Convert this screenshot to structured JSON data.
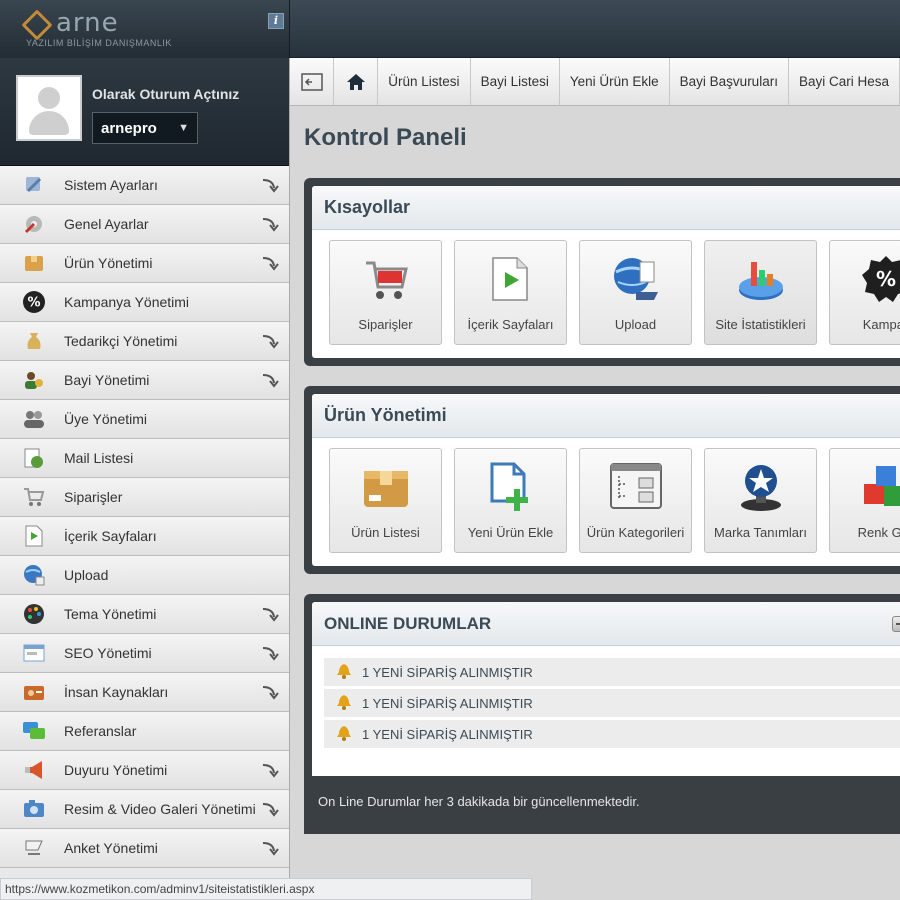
{
  "header": {
    "logo_text": "arne",
    "logo_subtitle": "YAZILIM BİLİŞİM DANIŞMANLIK",
    "info_label": "i"
  },
  "user": {
    "status_text": "Olarak Oturum Açtınız",
    "username": "arnepro"
  },
  "sidebar": {
    "items": [
      {
        "label": "Sistem Ayarları",
        "icon": "settings-tools-icon",
        "has_submenu": true
      },
      {
        "label": "Genel Ayarlar",
        "icon": "gear-wrench-icon",
        "has_submenu": true
      },
      {
        "label": "Ürün Yönetimi",
        "icon": "box-icon",
        "has_submenu": true
      },
      {
        "label": "Kampanya Yönetimi",
        "icon": "percent-badge-icon",
        "has_submenu": false
      },
      {
        "label": "Tedarikçi Yönetimi",
        "icon": "money-bag-icon",
        "has_submenu": true
      },
      {
        "label": "Bayi Yönetimi",
        "icon": "dealer-people-icon",
        "has_submenu": true
      },
      {
        "label": "Üye Yönetimi",
        "icon": "members-icon",
        "has_submenu": false
      },
      {
        "label": "Mail Listesi",
        "icon": "mail-list-icon",
        "has_submenu": false
      },
      {
        "label": "Siparişler",
        "icon": "shopping-cart-icon",
        "has_submenu": false
      },
      {
        "label": "İçerik Sayfaları",
        "icon": "content-page-icon",
        "has_submenu": false
      },
      {
        "label": "Upload",
        "icon": "upload-globe-icon",
        "has_submenu": false
      },
      {
        "label": "Tema Yönetimi",
        "icon": "palette-icon",
        "has_submenu": true
      },
      {
        "label": "SEO Yönetimi",
        "icon": "seo-window-icon",
        "has_submenu": true
      },
      {
        "label": "İnsan Kaynakları",
        "icon": "id-card-icon",
        "has_submenu": true
      },
      {
        "label": "Referanslar",
        "icon": "chat-bubbles-icon",
        "has_submenu": false
      },
      {
        "label": "Duyuru Yönetimi",
        "icon": "megaphone-icon",
        "has_submenu": true
      },
      {
        "label": "Resim & Video Galeri Yönetimi",
        "icon": "camera-icon",
        "has_submenu": true
      },
      {
        "label": "Anket Yönetimi",
        "icon": "poll-icon",
        "has_submenu": true
      }
    ]
  },
  "navbar": {
    "links": [
      "Ürün Listesi",
      "Bayi Listesi",
      "Yeni Ürün Ekle",
      "Bayi Başvuruları",
      "Bayi Cari Hesa"
    ]
  },
  "page": {
    "title": "Kontrol Paneli"
  },
  "shortcuts": {
    "title": "Kısayollar",
    "tiles": [
      {
        "label": "Siparişler",
        "icon": "shopping-cart-icon"
      },
      {
        "label": "İçerik Sayfaları",
        "icon": "content-page-icon"
      },
      {
        "label": "Upload",
        "icon": "upload-globe-icon"
      },
      {
        "label": "Site İstatistikleri",
        "icon": "statistics-chart-icon"
      },
      {
        "label": "Kampar",
        "icon": "percent-badge-icon"
      }
    ]
  },
  "product_management": {
    "title": "Ürün Yönetimi",
    "tiles": [
      {
        "label": "Ürün Listesi",
        "icon": "box-icon"
      },
      {
        "label": "Yeni Ürün Ekle",
        "icon": "add-document-icon"
      },
      {
        "label": "Ürün Kategorileri",
        "icon": "categories-window-icon"
      },
      {
        "label": "Marka Tanımları",
        "icon": "brand-star-icon"
      },
      {
        "label": "Renk Gru",
        "icon": "color-cubes-icon"
      }
    ]
  },
  "online": {
    "title": "ONLINE DURUMLAR",
    "items": [
      "1 YENİ SİPARİŞ ALINMIŞTIR",
      "1 YENİ SİPARİŞ ALINMIŞTIR",
      "1 YENİ SİPARİŞ ALINMIŞTIR"
    ],
    "footnote": "On Line Durumlar her 3 dakikada bir güncellenmektedir."
  },
  "statusbar": {
    "url": "https://www.kozmetikon.com/adminv1/siteistatistikleri.aspx"
  }
}
